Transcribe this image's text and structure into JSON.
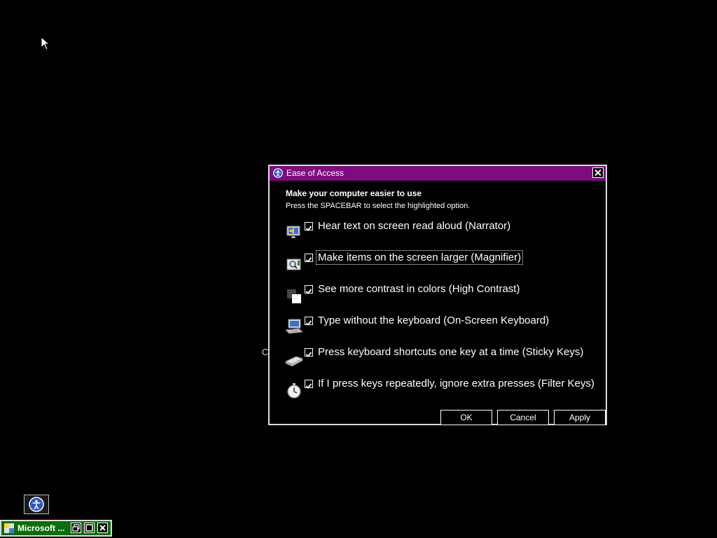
{
  "dialog": {
    "title": "Ease of Access",
    "heading": "Make your computer easier to use",
    "subheading": "Press the SPACEBAR to select the highlighted option.",
    "options": [
      {
        "label": "Hear text on screen read aloud (Narrator)",
        "icon": "narrator-icon",
        "checked": true
      },
      {
        "label": "Make items on the screen larger (Magnifier)",
        "icon": "magnifier-icon",
        "checked": true
      },
      {
        "label": "See more contrast in colors (High Contrast)",
        "icon": "high-contrast-icon",
        "checked": true
      },
      {
        "label": "Type without the keyboard (On-Screen Keyboard)",
        "icon": "on-screen-keyboard-icon",
        "checked": true
      },
      {
        "label": "Press keyboard shortcuts one key at a time (Sticky Keys)",
        "icon": "sticky-keys-icon",
        "checked": true
      },
      {
        "label": "If I press keys repeatedly, ignore extra presses (Filter Keys)",
        "icon": "filter-keys-icon",
        "checked": true
      }
    ],
    "buttons": {
      "ok": "OK",
      "cancel": "Cancel",
      "apply": "Apply"
    }
  },
  "background_stray_text": "C",
  "taskbar": {
    "button_label": "Microsoft ..."
  },
  "colors": {
    "titlebar": "#7d0c7e",
    "taskbar_button": "#0a6e0a",
    "background": "#000000"
  }
}
